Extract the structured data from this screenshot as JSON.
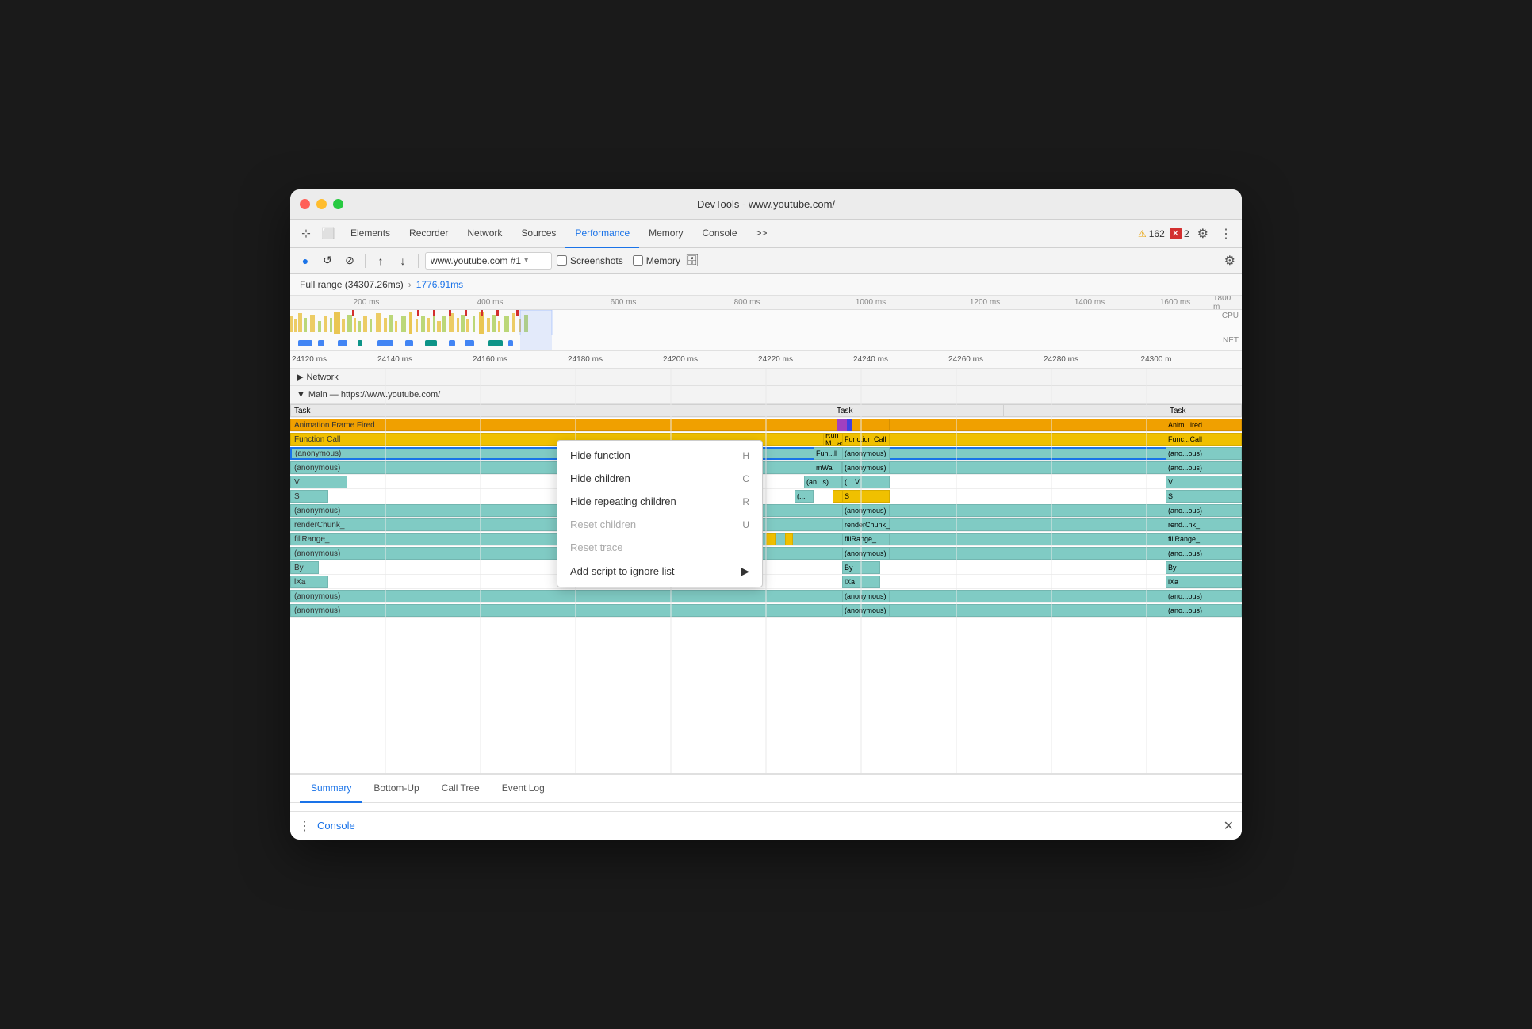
{
  "window": {
    "title": "DevTools - www.youtube.com/"
  },
  "tabs": {
    "items": [
      "Elements",
      "Recorder",
      "Network",
      "Sources",
      "Performance",
      "Memory",
      "Console",
      ">>"
    ],
    "active": "Performance"
  },
  "toolbar": {
    "record_label": "●",
    "refresh_label": "↺",
    "clear_label": "⊘",
    "upload_label": "↑",
    "download_label": "↓",
    "url_value": "www.youtube.com #1",
    "screenshots_label": "Screenshots",
    "memory_label": "Memory",
    "settings_label": "⚙"
  },
  "range": {
    "full_range": "Full range (34307.26ms)",
    "selected": "1776.91ms",
    "chevron": "›"
  },
  "ruler": {
    "ticks": [
      "200 ms",
      "400 ms",
      "600 ms",
      "800 ms",
      "1000 ms",
      "1200 ms",
      "1400 ms",
      "1600 ms",
      "1800 m"
    ],
    "detail_ticks": [
      "24120 ms",
      "24140 ms",
      "24160 ms",
      "24180 ms",
      "24200 ms",
      "24220 ms",
      "24240 ms",
      "24260 ms",
      "24280 ms",
      "24300 m"
    ]
  },
  "network_section": {
    "label": "Network",
    "expanded": false
  },
  "main_section": {
    "label": "Main — https://www.youtube.com/"
  },
  "flame_rows": [
    {
      "label": "Task",
      "color": "#e8e8e8",
      "type": "task"
    },
    {
      "label": "Animation Frame Fired",
      "color": "#f0a000",
      "type": "anim"
    },
    {
      "label": "Function Call",
      "color": "#f0c000",
      "type": "func"
    },
    {
      "label": "(anonymous)",
      "color": "#80cbc4",
      "type": "anon",
      "selected": true
    },
    {
      "label": "(anonymous)",
      "color": "#80cbc4"
    },
    {
      "label": "V",
      "color": "#80cbc4"
    },
    {
      "label": "S",
      "color": "#80cbc4"
    },
    {
      "label": "(anonymous)",
      "color": "#80cbc4"
    },
    {
      "label": "renderChunk_",
      "color": "#80cbc4"
    },
    {
      "label": "fillRange_",
      "color": "#80cbc4"
    },
    {
      "label": "(anonymous)",
      "color": "#80cbc4"
    },
    {
      "label": "By",
      "color": "#80cbc4"
    },
    {
      "label": "lXa",
      "color": "#80cbc4"
    },
    {
      "label": "(anonymous)",
      "color": "#80cbc4"
    },
    {
      "label": "(anonymous)",
      "color": "#80cbc4"
    }
  ],
  "right_column": {
    "labels": [
      "Task",
      "Animation Frame Fired",
      "Function Call",
      "(anonymous)",
      "(anonymous)",
      "(... V",
      "S",
      "(anonymous)",
      "renderChunk_",
      "fillRange_",
      "(anonymous)",
      "By",
      "lXa",
      "(anonymous)",
      "(anonymous)"
    ],
    "colors": [
      "#e8e8e8",
      "#f0a000",
      "#f0c000",
      "#80cbc4",
      "#80cbc4",
      "#80cbc4",
      "#f0c000",
      "#80cbc4",
      "#80cbc4",
      "#80cbc4",
      "#80cbc4",
      "#80cbc4",
      "#80cbc4",
      "#80cbc4",
      "#80cbc4"
    ]
  },
  "far_right_column": {
    "labels": [
      "Task",
      "Anim...ired",
      "Func...Call",
      "(ano...ous)",
      "(ano...ous)",
      "V",
      "S",
      "(ano...ous)",
      "rend...nk_",
      "fillRange_",
      "(ano...ous)",
      "By",
      "lXa",
      "(ano...ous)",
      "(ano...ous)"
    ],
    "colors": [
      "#e8e8e8",
      "#f0a000",
      "#f0c000",
      "#80cbc4",
      "#80cbc4",
      "#80cbc4",
      "#f0c000",
      "#80cbc4",
      "#80cbc4",
      "#80cbc4",
      "#80cbc4",
      "#80cbc4",
      "#80cbc4",
      "#80cbc4",
      "#80cbc4"
    ]
  },
  "middle_labels": [
    "Fun...ll",
    "mWa",
    "(an...s)",
    "(..."
  ],
  "right_middle_labels": [
    "Run M...asks"
  ],
  "context_menu": {
    "items": [
      {
        "label": "Hide function",
        "shortcut": "H",
        "enabled": true
      },
      {
        "label": "Hide children",
        "shortcut": "C",
        "enabled": true
      },
      {
        "label": "Hide repeating children",
        "shortcut": "R",
        "enabled": true
      },
      {
        "label": "Reset children",
        "shortcut": "U",
        "enabled": false
      },
      {
        "label": "Reset trace",
        "shortcut": "",
        "enabled": false
      },
      {
        "label": "Add script to ignore list",
        "shortcut": "",
        "enabled": true
      }
    ],
    "cursor": "▶"
  },
  "bottom_tabs": {
    "items": [
      "Summary",
      "Bottom-Up",
      "Call Tree",
      "Event Log"
    ],
    "active": "Summary"
  },
  "console_bar": {
    "dots": "⋮",
    "label": "Console",
    "close": "✕"
  },
  "alerts": {
    "warn_icon": "⚠",
    "warn_count": "162",
    "err_icon": "✕",
    "err_count": "2"
  }
}
